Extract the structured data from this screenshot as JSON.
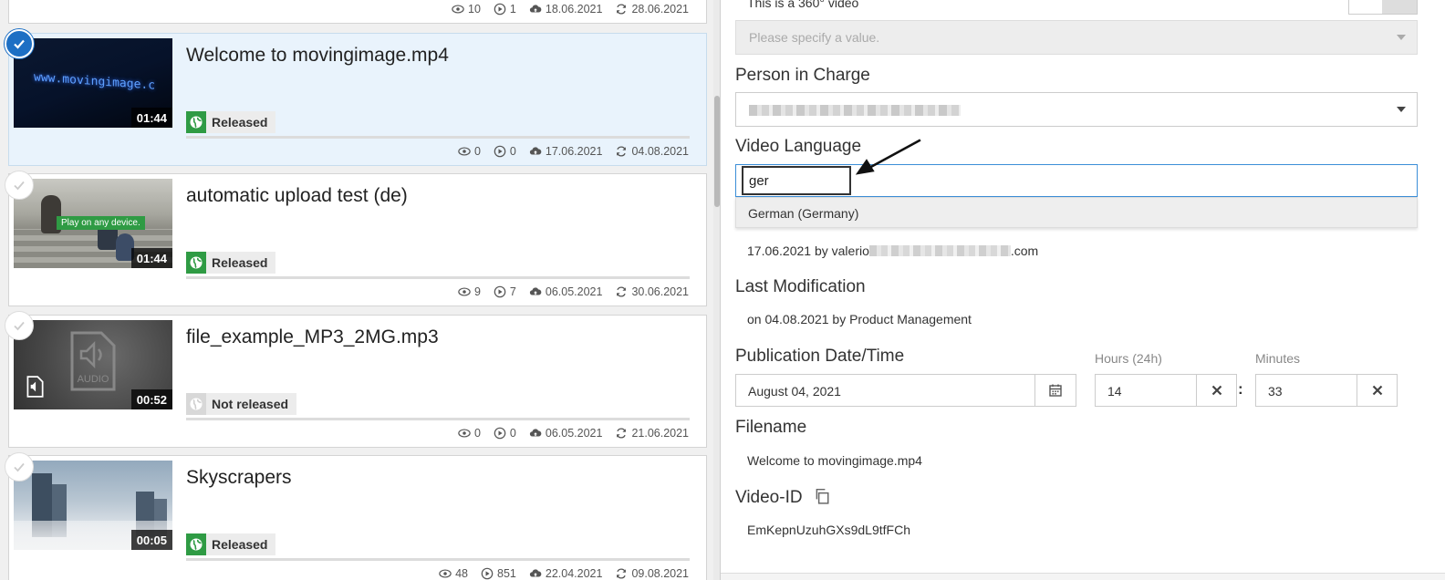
{
  "top_card_stats": {
    "views": "10",
    "plays": "1",
    "uploaded": "18.06.2021",
    "modified": "28.06.2021"
  },
  "videos": [
    {
      "title": "Welcome to movingimage.mp4",
      "duration": "01:44",
      "status": "Released",
      "views": "0",
      "plays": "0",
      "uploaded": "17.06.2021",
      "modified": "04.08.2021",
      "thumb_text": "www.movingimage.c"
    },
    {
      "title": "automatic upload test (de)",
      "duration": "01:44",
      "status": "Released",
      "views": "9",
      "plays": "7",
      "uploaded": "06.05.2021",
      "modified": "30.06.2021",
      "thumb_text": "Play on any device."
    },
    {
      "title": "file_example_MP3_2MG.mp3",
      "duration": "00:52",
      "status": "Not released",
      "views": "0",
      "plays": "0",
      "uploaded": "06.05.2021",
      "modified": "21.06.2021",
      "thumb_text": "AUDIO"
    },
    {
      "title": "Skyscrapers",
      "duration": "00:05",
      "status": "Released",
      "views": "48",
      "plays": "851",
      "uploaded": "22.04.2021",
      "modified": "09.08.2021",
      "thumb_text": ""
    }
  ],
  "panel": {
    "video360_label": "This is a 360° video",
    "specify_placeholder": "Please specify a value.",
    "person_in_charge_label": "Person in Charge",
    "video_language_label": "Video Language",
    "language_input_value": "ger",
    "language_option": "German (Germany)",
    "created_prefix": "17.06.2021 by valerio",
    "created_suffix": ".com",
    "last_modification_label": "Last Modification",
    "last_modification_value": "on 04.08.2021 by Product Management",
    "publication_label": "Publication Date/Time",
    "publication_date": "August 04, 2021",
    "hours_label": "Hours (24h)",
    "hours_value": "14",
    "minutes_label": "Minutes",
    "minutes_value": "33",
    "colon": ":",
    "filename_label": "Filename",
    "filename_value": "Welcome to movingimage.mp4",
    "video_id_label": "Video-ID",
    "video_id_value": "EmKepnUzuhGXs9dL9tfFCh"
  },
  "colors": {
    "accent": "#1d6fc4",
    "released": "#2f9b44",
    "selected_bg": "#e9f3fc"
  }
}
